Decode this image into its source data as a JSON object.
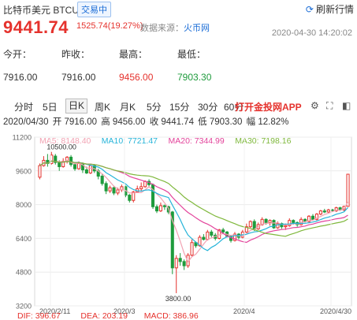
{
  "header": {
    "name": "比特币美元 BTCUSDT",
    "status": "交易中",
    "refresh": "刷新行情"
  },
  "quote": {
    "price": "9441.74",
    "change": "1525.74(19.27%)",
    "source_label": "数据来源：",
    "source_link": "火币网",
    "timestamp": "2020-04-30 14:20:02"
  },
  "stats": [
    {
      "label": "今开：",
      "value": "7916.00",
      "color": "#333333"
    },
    {
      "label": "昨收：",
      "value": "7916.00",
      "color": "#333333"
    },
    {
      "label": "最高：",
      "value": "9456.00",
      "color": "#e5322d"
    },
    {
      "label": "最低：",
      "value": "7903.30",
      "color": "#1e9b3c"
    }
  ],
  "tabs": [
    "分时",
    "5日",
    "日K",
    "周K",
    "月K",
    "5分",
    "15分",
    "30分",
    "60分"
  ],
  "active_tab": "日K",
  "app_tab": "打开金投网APP",
  "tool_icons": [
    "settings-icon",
    "fullscreen-icon",
    "dock-icon"
  ],
  "ohlc_line": {
    "date": "2020/04/30",
    "open": "开 7916.00",
    "high": "高 9456.00",
    "close": "收 9441.74",
    "low": "低 7903.30",
    "amp": "幅 12.82%"
  },
  "ma_legend": [
    {
      "label": "MA5: 8148.40",
      "color": "#f2a3b3"
    },
    {
      "label": "MA10: 7721.47",
      "color": "#26b4d9"
    },
    {
      "label": "MA20: 7344.99",
      "color": "#e3439b"
    },
    {
      "label": "MA30: 7198.16",
      "color": "#7fb83c"
    }
  ],
  "bottom_legend": [
    {
      "label": "DIF: 396.67",
      "color": "#e5322d"
    },
    {
      "label": "DEA: 203.19",
      "color": "#e5322d"
    },
    {
      "label": "MACD: 386.96",
      "color": "#e5322d"
    }
  ],
  "colors": {
    "up": "#e5322d",
    "down": "#1e9b3c"
  },
  "chart_data": {
    "type": "candlestick",
    "y_ticks": [
      "11200",
      "9600",
      "8000",
      "6400",
      "4800",
      "3200"
    ],
    "ylim": [
      3200,
      11200
    ],
    "x_ticks": [
      "2020/2/11",
      "2020/3",
      "2020/4",
      "2020/4/30"
    ],
    "high_label": "10500.00",
    "low_label": "3800.00",
    "candles": [
      [
        9300,
        9850,
        9200,
        9950
      ],
      [
        9850,
        10100,
        9800,
        10300
      ],
      [
        10100,
        9950,
        9800,
        10400
      ],
      [
        9950,
        10350,
        9900,
        10500
      ],
      [
        10300,
        10000,
        9900,
        10400
      ],
      [
        10000,
        9800,
        9600,
        10100
      ],
      [
        9800,
        10050,
        9750,
        10200
      ],
      [
        10050,
        10250,
        9950,
        10300
      ],
      [
        10250,
        9900,
        9800,
        10350
      ],
      [
        9900,
        9700,
        9600,
        10000
      ],
      [
        9700,
        9950,
        9650,
        10050
      ],
      [
        9950,
        9650,
        9500,
        10000
      ],
      [
        9650,
        9500,
        9450,
        9800
      ],
      [
        9500,
        9850,
        9450,
        9900
      ],
      [
        9850,
        9600,
        9500,
        9900
      ],
      [
        9600,
        9350,
        9200,
        9700
      ],
      [
        9350,
        9000,
        8900,
        9450
      ],
      [
        9000,
        8650,
        8500,
        9100
      ],
      [
        8650,
        8800,
        8550,
        8900
      ],
      [
        8800,
        8550,
        8450,
        8900
      ],
      [
        8550,
        8700,
        8450,
        8800
      ],
      [
        8700,
        8850,
        8600,
        8950
      ],
      [
        8850,
        8450,
        8350,
        8900
      ],
      [
        8450,
        8200,
        8100,
        8500
      ],
      [
        8200,
        8600,
        8100,
        8650
      ],
      [
        8600,
        8750,
        8550,
        8900
      ],
      [
        8750,
        8850,
        8650,
        9050
      ],
      [
        8850,
        9100,
        8800,
        9150
      ],
      [
        9100,
        8950,
        8850,
        9200
      ],
      [
        8950,
        7900,
        7800,
        9000
      ],
      [
        7900,
        7700,
        7600,
        8000
      ],
      [
        7700,
        7950,
        7650,
        8100
      ],
      [
        7950,
        7900,
        7750,
        8000
      ],
      [
        7900,
        7650,
        7550,
        7950
      ],
      [
        7650,
        5000,
        4700,
        7700
      ],
      [
        5000,
        5450,
        3800,
        5600
      ],
      [
        5450,
        5300,
        5100,
        5700
      ],
      [
        5300,
        5100,
        4900,
        5400
      ],
      [
        5100,
        5600,
        5000,
        5700
      ],
      [
        5600,
        6200,
        5550,
        6350
      ],
      [
        6200,
        6050,
        5950,
        6250
      ],
      [
        6050,
        6450,
        6000,
        6550
      ],
      [
        6450,
        6350,
        6300,
        6600
      ],
      [
        6350,
        6700,
        6300,
        6800
      ],
      [
        6700,
        6550,
        6450,
        6800
      ],
      [
        6550,
        6400,
        6300,
        6650
      ],
      [
        6400,
        6800,
        6350,
        6850
      ],
      [
        6800,
        6700,
        6600,
        6900
      ],
      [
        6700,
        6500,
        6450,
        6750
      ],
      [
        6500,
        6300,
        6200,
        6550
      ],
      [
        6300,
        6600,
        6250,
        6700
      ],
      [
        6600,
        6450,
        6350,
        6650
      ],
      [
        6450,
        6700,
        6400,
        6800
      ],
      [
        6700,
        6950,
        6650,
        7100
      ],
      [
        6950,
        7200,
        6900,
        7250
      ],
      [
        7200,
        6850,
        6750,
        7300
      ],
      [
        6850,
        7050,
        6800,
        7150
      ],
      [
        7050,
        7300,
        7000,
        7400
      ],
      [
        7300,
        7150,
        7050,
        7350
      ],
      [
        7150,
        7250,
        7000,
        7300
      ],
      [
        7250,
        6900,
        6850,
        7300
      ],
      [
        6900,
        7100,
        6850,
        7200
      ],
      [
        7100,
        6950,
        6850,
        7150
      ],
      [
        6950,
        7000,
        6800,
        7100
      ],
      [
        7000,
        7250,
        6950,
        7350
      ],
      [
        7250,
        7150,
        7050,
        7300
      ],
      [
        7150,
        7050,
        6950,
        7200
      ],
      [
        7050,
        7300,
        7000,
        7400
      ],
      [
        7300,
        7200,
        7150,
        7350
      ],
      [
        7200,
        7450,
        7150,
        7500
      ],
      [
        7450,
        7300,
        7250,
        7550
      ],
      [
        7300,
        7550,
        7250,
        7600
      ],
      [
        7550,
        7700,
        7500,
        7750
      ],
      [
        7700,
        7650,
        7600,
        7800
      ],
      [
        7650,
        7750,
        7600,
        7800
      ],
      [
        7750,
        7700,
        7650,
        7800
      ],
      [
        7700,
        7850,
        7650,
        7900
      ],
      [
        7850,
        7750,
        7700,
        7900
      ],
      [
        7750,
        7916,
        7700,
        7950
      ],
      [
        7916,
        9441.74,
        7903.3,
        9456
      ]
    ]
  }
}
